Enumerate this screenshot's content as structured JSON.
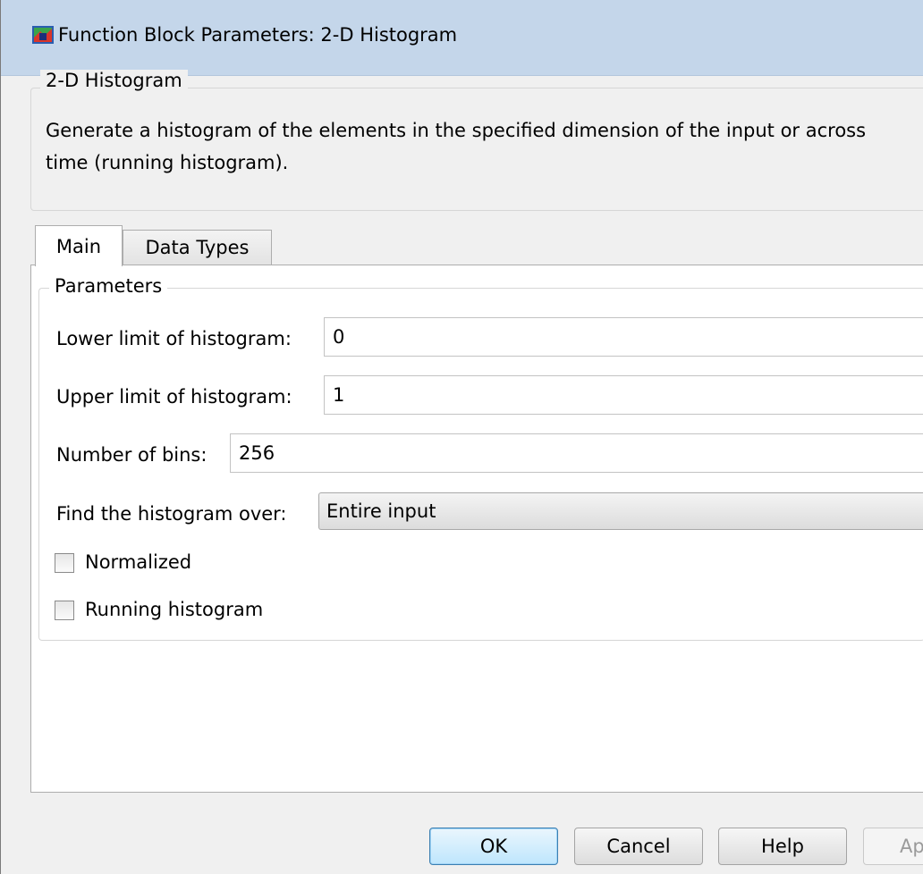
{
  "window": {
    "title": "Function Block Parameters: 2-D Histogram"
  },
  "block": {
    "group_title": "2-D Histogram",
    "description_line1": "Generate a histogram of the elements in the specified dimension of the input or across",
    "description_line2": "time (running histogram)."
  },
  "tabs": [
    {
      "label": "Main",
      "active": true
    },
    {
      "label": "Data Types",
      "active": false
    }
  ],
  "parameters": {
    "group_title": "Parameters",
    "lower_limit": {
      "label": "Lower limit of histogram:",
      "value": "0"
    },
    "upper_limit": {
      "label": "Upper limit of histogram:",
      "value": "1"
    },
    "num_bins": {
      "label": "Number of bins:",
      "value": "256"
    },
    "find_over": {
      "label": "Find the histogram over:",
      "value": "Entire input"
    },
    "normalized": {
      "label": "Normalized",
      "checked": false
    },
    "running": {
      "label": "Running histogram",
      "checked": false
    }
  },
  "buttons": {
    "ok": "OK",
    "cancel": "Cancel",
    "help": "Help",
    "apply": "Ap"
  },
  "colors": {
    "titlebar": "#c4d6ea",
    "default_button": "#bee6fd"
  }
}
